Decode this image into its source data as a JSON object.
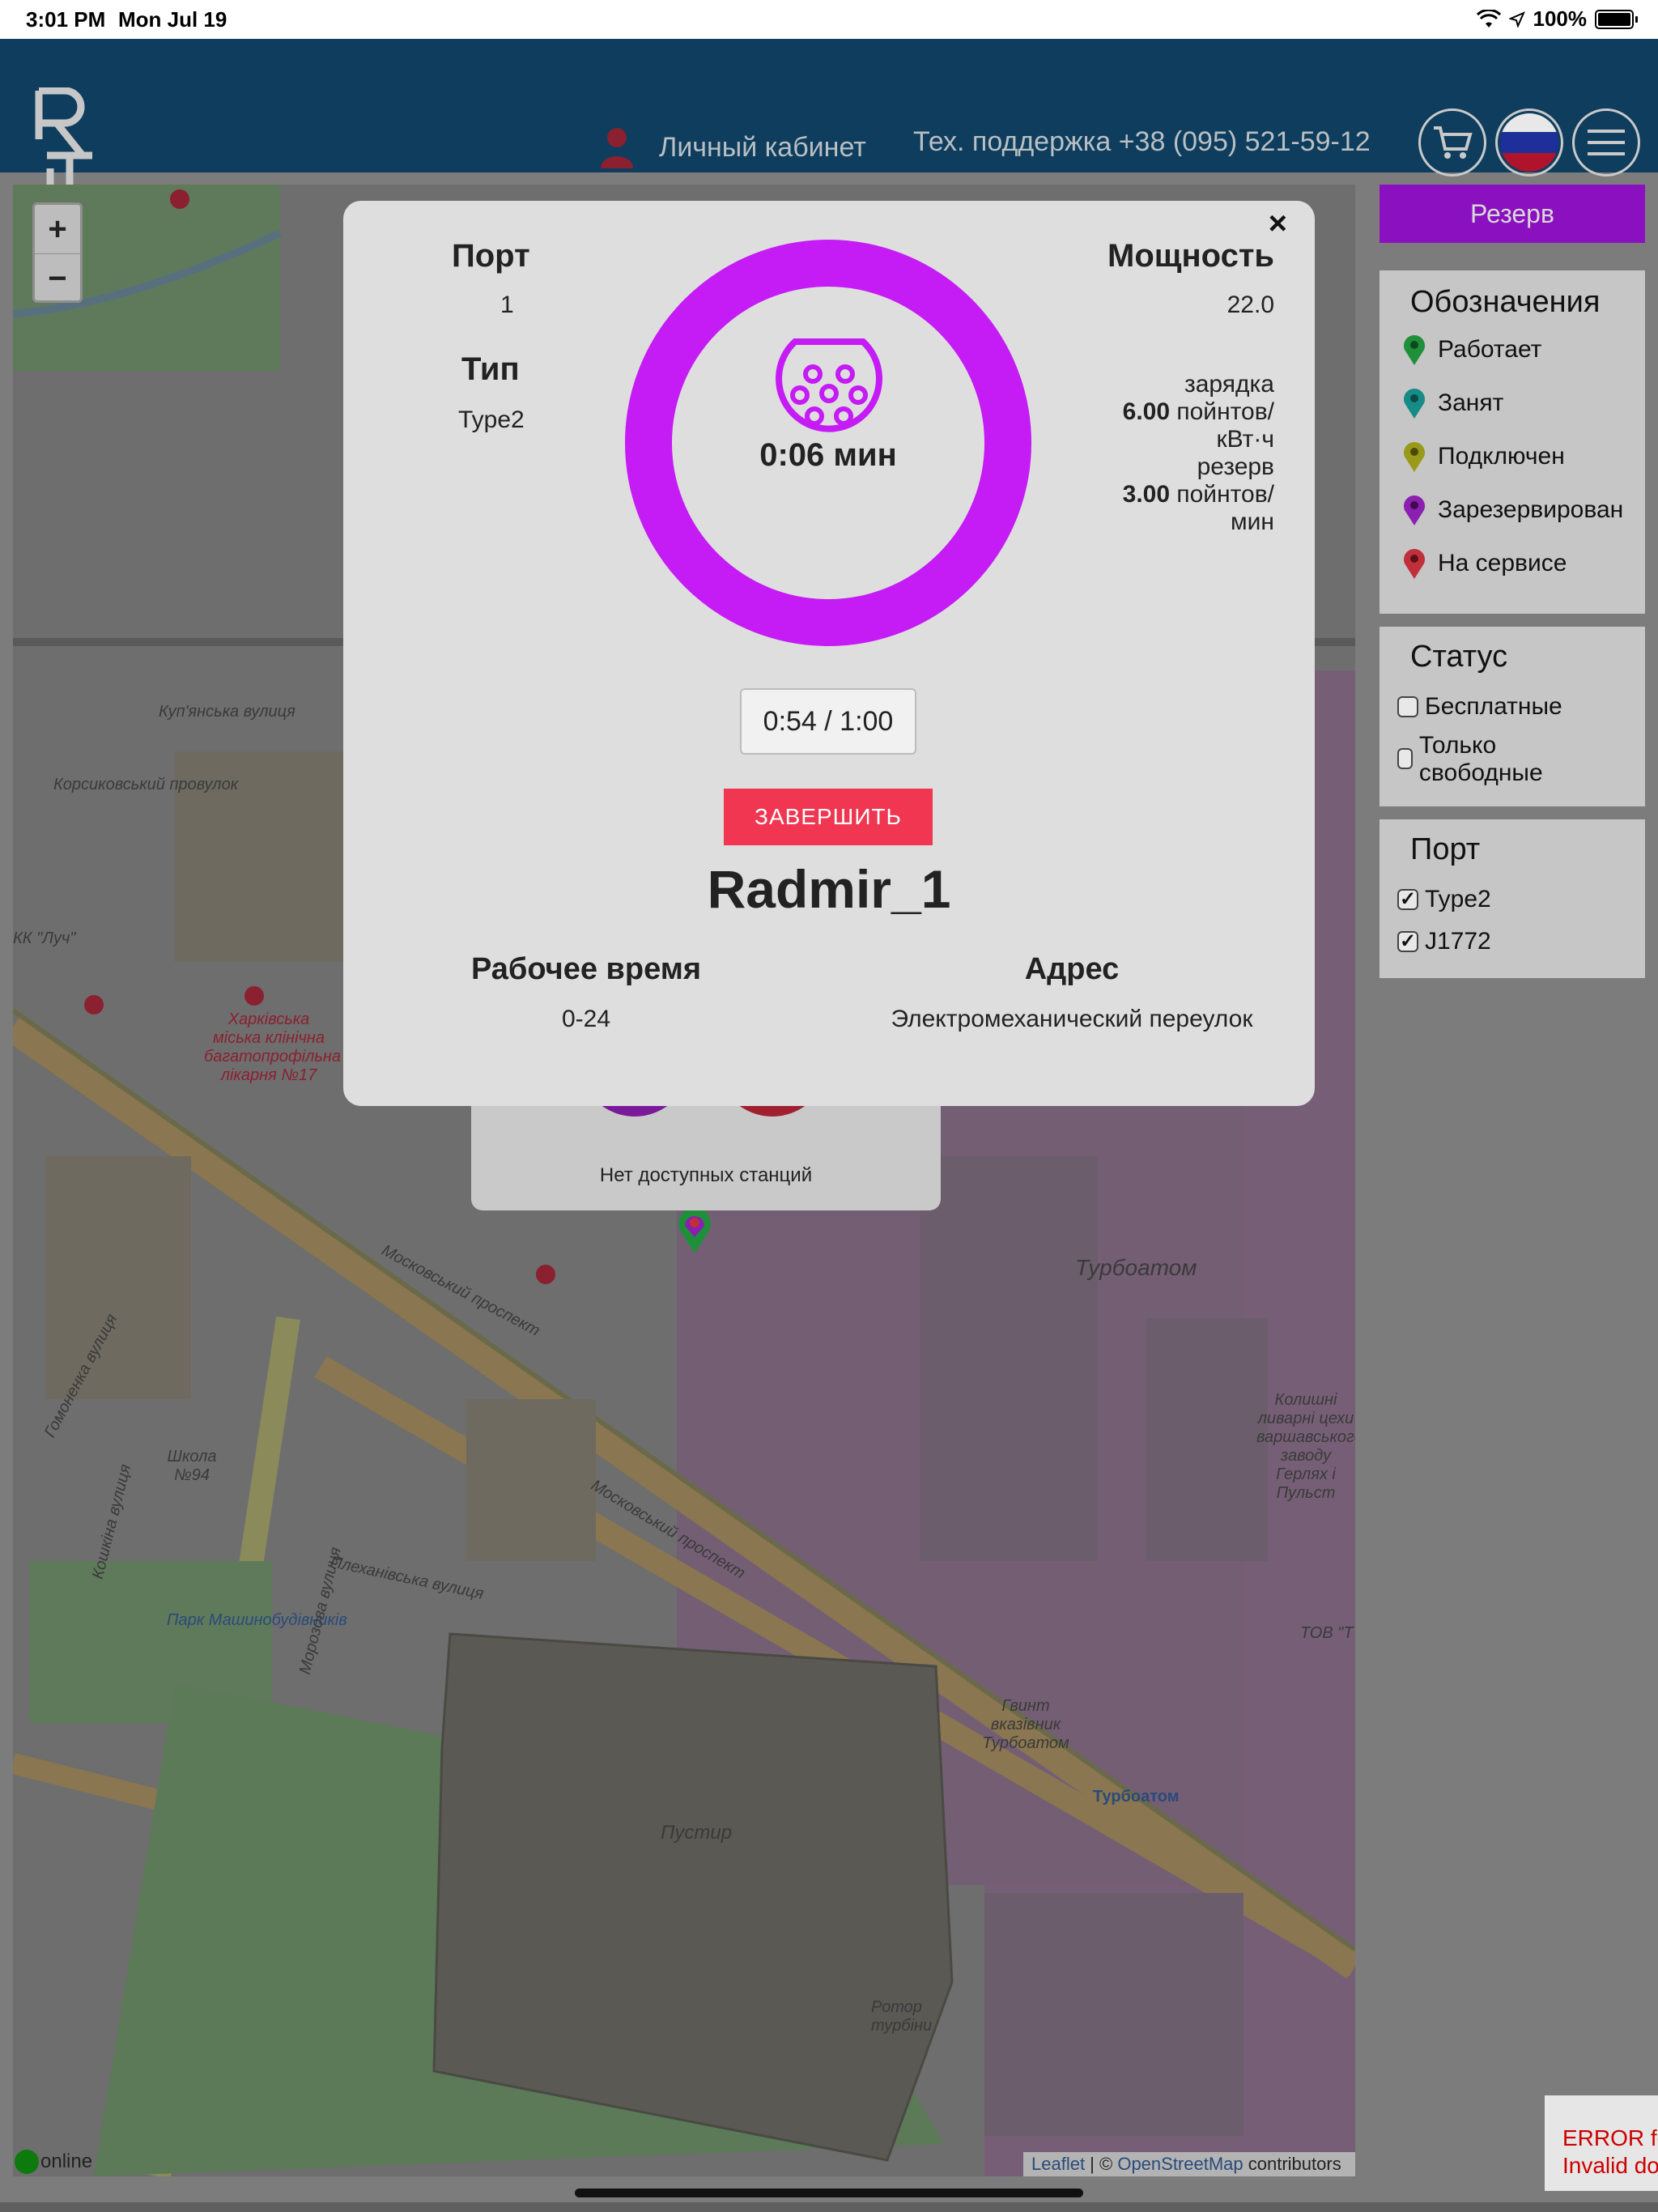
{
  "status_bar": {
    "time": "3:01 PM",
    "date": "Mon Jul 19",
    "battery": "100%"
  },
  "header": {
    "account_label": "Личный кабинет",
    "support_label": "Тех. поддержка +38 (095) 521-59-12"
  },
  "map": {
    "zoom_in": "+",
    "zoom_out": "−",
    "labels": {
      "street1": "Куп'янська вулиця",
      "street2": "Корсиковський провулок",
      "hospital": "Харківська міська клінічна багатопрофільна лікарня №17",
      "turboatom": "Турбоатом",
      "prospect1": "Московський проспект",
      "prospect2": "Московський проспект",
      "plekhanivska": "Плеханівська вулиця",
      "park": "Парк Машинобудівників",
      "school": "Школа №94",
      "pustyr": "Пустир",
      "turboatom_station": "Турбоатом",
      "rotor": "Ротор турбіни",
      "vint": "Гвинт вказівник Турбоатом",
      "foundry": "Колишні ливарні цехи варшавського заводу Герлях і Пульст",
      "morozova": "Морозова вулиця",
      "koshkina": "Кошкіна вулиця",
      "tov": "ТОВ \"Т",
      "luch": "КК \"Луч\"",
      "gomonenka": "Гомоненка вулиця"
    },
    "station_popup_text": "Нет доступных станций",
    "online_label": "online",
    "attribution": {
      "leaflet": "Leaflet",
      "sep": " | © ",
      "osm": "OpenStreetMap",
      "contrib": " contributors"
    }
  },
  "modal": {
    "close": "×",
    "port_title": "Порт",
    "port_value": "1",
    "type_title": "Тип",
    "type_value": "Type2",
    "power_title": "Мощность",
    "power_value": "22.0",
    "charge_label": "зарядка",
    "charge_price": "6.00",
    "charge_unit1": "пойнтов/",
    "charge_unit2": "кВт·ч",
    "reserve_label": "резерв",
    "reserve_price": "3.00",
    "reserve_unit1": "пойнтов/",
    "reserve_unit2": "мин",
    "timer": "0:06 мин",
    "progress": "0:54 / 1:00",
    "finish_button": "ЗАВЕРШИТЬ",
    "station_name": "Radmir_1",
    "hours_title": "Рабочее время",
    "hours_value": "0-24",
    "address_title": "Адрес",
    "address_value": "Электромеханический переулок"
  },
  "sidebar": {
    "reserve_button": "Резерв",
    "legend_title": "Обозначения",
    "legend": [
      {
        "label": "Работает",
        "color": "#1f8f3a"
      },
      {
        "label": "Занят",
        "color": "#178c86"
      },
      {
        "label": "Подключен",
        "color": "#9a9a1a"
      },
      {
        "label": "Зарезервирован",
        "color": "#8b1fb0"
      },
      {
        "label": "На сервисе",
        "color": "#c0303a"
      }
    ],
    "status_title": "Статус",
    "status_options": [
      {
        "label": "Бесплатные",
        "checked": false
      },
      {
        "label": "Только свободные",
        "checked": false
      }
    ],
    "port_title": "Порт",
    "port_options": [
      {
        "label": "Type2",
        "checked": true
      },
      {
        "label": "J1772",
        "checked": true
      }
    ]
  },
  "error": {
    "line1": "ERROR fo",
    "line2": "Invalid do"
  }
}
